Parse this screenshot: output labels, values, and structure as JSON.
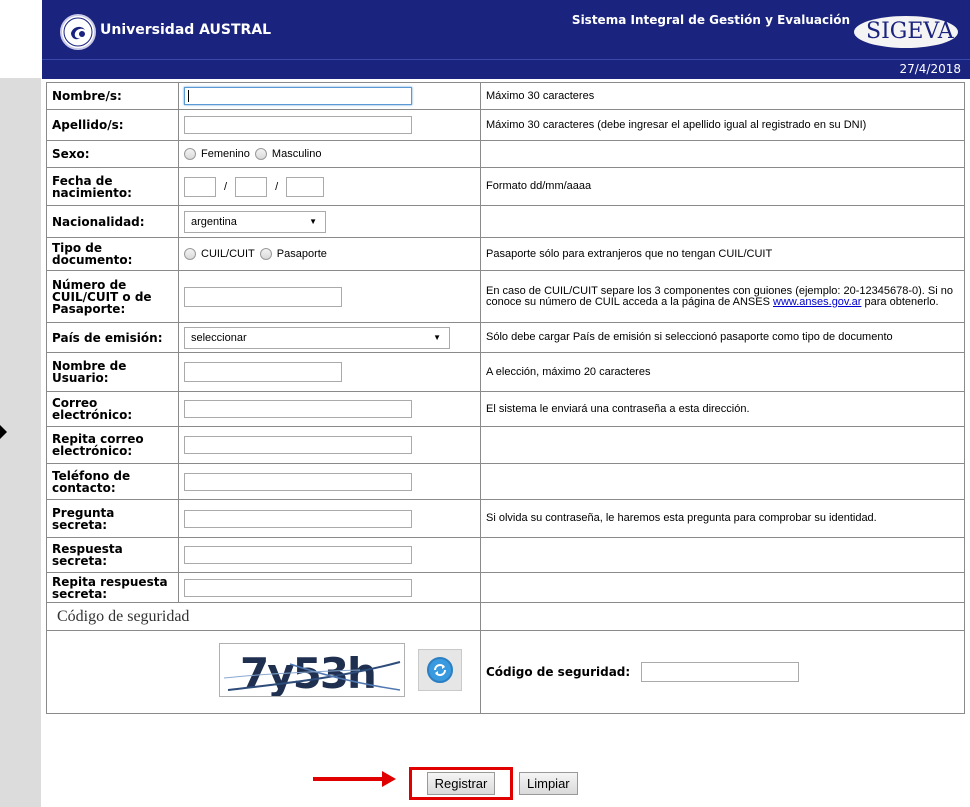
{
  "header": {
    "university": "Universidad AUSTRAL",
    "system": "Sistema Integral de Gestión y Evaluación",
    "brand": "SIGEVA",
    "date": "27/4/2018"
  },
  "form": {
    "nombre": {
      "label": "Nombre/s:",
      "value": "",
      "hint": "Máximo 30 caracteres"
    },
    "apellido": {
      "label": "Apellido/s:",
      "value": "",
      "hint": "Máximo 30 caracteres (debe ingresar el apellido igual al registrado en su DNI)"
    },
    "sexo": {
      "label": "Sexo:",
      "option1": "Femenino",
      "option2": "Masculino"
    },
    "fecha": {
      "label": "Fecha de nacimiento:",
      "sep": "/",
      "hint": "Formato dd/mm/aaaa"
    },
    "nacionalidad": {
      "label": "Nacionalidad:",
      "selected": "argentina"
    },
    "tipo_doc": {
      "label": "Tipo de documento:",
      "option1": "CUIL/CUIT",
      "option2": "Pasaporte",
      "hint": "Pasaporte sólo para extranjeros que no tengan CUIL/CUIT"
    },
    "numero": {
      "label": "Número de CUIL/CUIT o de Pasaporte:",
      "hint": "En caso de CUIL/CUIT separe los 3 componentes con guiones (ejemplo: 20-12345678-0). Si no conoce su número de CUIL acceda a la página de ANSES",
      "link": "www.anses.gov.ar",
      "hint_tail": "para obtenerlo."
    },
    "pais": {
      "label": "País de emisión:",
      "selected": "seleccionar",
      "hint": "Sólo debe cargar País de emisión si seleccionó pasaporte como tipo de documento"
    },
    "usuario": {
      "label": "Nombre de Usuario:",
      "hint": "A elección, máximo 20 caracteres"
    },
    "correo": {
      "label": "Correo electrónico:",
      "hint": "El sistema le enviará una contraseña a esta dirección."
    },
    "repita_correo": {
      "label": "Repita correo electrónico:"
    },
    "telefono": {
      "label": "Teléfono de contacto:"
    },
    "pregunta": {
      "label": "Pregunta secreta:",
      "hint": "Si olvida su contraseña, le haremos esta pregunta para comprobar su identidad."
    },
    "respuesta": {
      "label": "Respuesta secreta:"
    },
    "repita_respuesta": {
      "label": "Repita respuesta secreta:"
    }
  },
  "captcha": {
    "section_title": "Código de seguridad",
    "text": "7y53h",
    "field_label": "Código de seguridad:"
  },
  "buttons": {
    "registrar": "Registrar",
    "limpiar": "Limpiar"
  },
  "icons": {
    "logo": "university-seal-icon",
    "refresh": "refresh-icon"
  },
  "colors": {
    "header_bg": "#1a237e",
    "highlight": "#e00000",
    "link": "#0000cc"
  }
}
